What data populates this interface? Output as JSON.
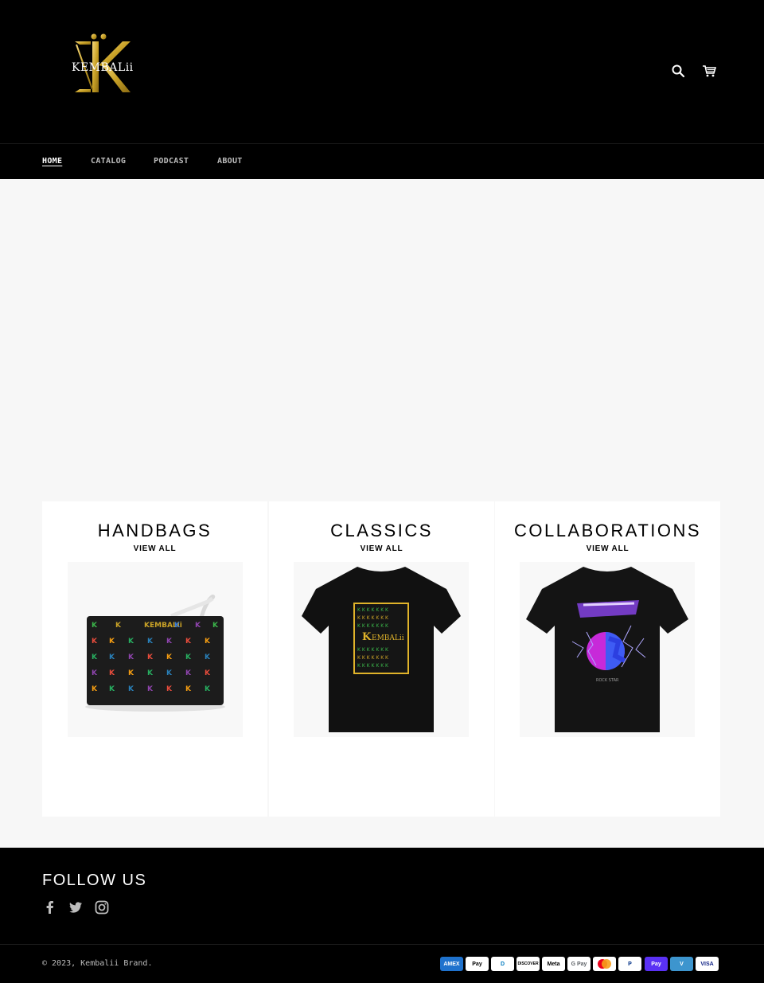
{
  "header": {
    "logo_text": "KEMBALii",
    "search_icon": "search-icon",
    "cart_icon": "cart-icon"
  },
  "nav": {
    "items": [
      {
        "label": "HOME",
        "active": true
      },
      {
        "label": "CATALOG",
        "active": false
      },
      {
        "label": "PODCAST",
        "active": false
      },
      {
        "label": "ABOUT",
        "active": false
      }
    ]
  },
  "collections": [
    {
      "title": "HANDBAGS",
      "link": "VIEW ALL",
      "image": "wristlet-clutch-bag"
    },
    {
      "title": "CLASSICS",
      "link": "VIEW ALL",
      "image": "black-tshirt-kembalii-logo"
    },
    {
      "title": "COLLABORATIONS",
      "link": "VIEW ALL",
      "image": "black-tshirt-androgynous-print"
    }
  ],
  "footer": {
    "follow_title": "FOLLOW US",
    "social": [
      "facebook-icon",
      "twitter-icon",
      "instagram-icon"
    ],
    "copyright": "© 2023, Kembalii Brand.",
    "payments": [
      {
        "name": "American Express",
        "label": "AMEX",
        "bg": "#1f72cd",
        "fg": "#ffffff"
      },
      {
        "name": "Apple Pay",
        "label": "Pay",
        "bg": "#ffffff",
        "fg": "#000000"
      },
      {
        "name": "Diners Club",
        "label": "D",
        "bg": "#ffffff",
        "fg": "#0079be"
      },
      {
        "name": "Discover",
        "label": "DISCOVER",
        "bg": "#ffffff",
        "fg": "#000000"
      },
      {
        "name": "Meta Pay",
        "label": "Meta",
        "bg": "#ffffff",
        "fg": "#000000"
      },
      {
        "name": "Google Pay",
        "label": "G Pay",
        "bg": "#ffffff",
        "fg": "#5f6368"
      },
      {
        "name": "Mastercard",
        "label": "",
        "bg": "#ffffff",
        "fg": "#000000"
      },
      {
        "name": "PayPal",
        "label": "P",
        "bg": "#ffffff",
        "fg": "#003087"
      },
      {
        "name": "Shop Pay",
        "label": "Pay",
        "bg": "#5a31f4",
        "fg": "#ffffff"
      },
      {
        "name": "Venmo",
        "label": "V",
        "bg": "#3d95ce",
        "fg": "#ffffff"
      },
      {
        "name": "Visa",
        "label": "VISA",
        "bg": "#ffffff",
        "fg": "#142688"
      }
    ]
  },
  "colors": {
    "background": "#f7f7f7",
    "header_bg": "#000000",
    "gold": "#c9a227",
    "nav_text": "#bdbdbd"
  }
}
